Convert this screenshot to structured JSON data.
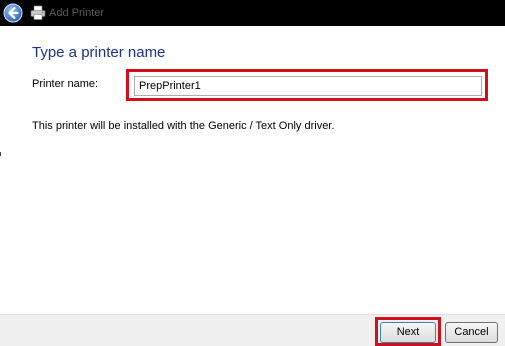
{
  "window": {
    "title": "Add Printer",
    "back_icon": "back-arrow-icon",
    "app_icon": "printer-icon"
  },
  "content": {
    "heading": "Type a printer name",
    "printer_name_label": "Printer name:",
    "printer_name_value": "PrepPrinter1",
    "driver_message": "This printer will be installed with the Generic / Text Only driver."
  },
  "footer": {
    "next_label": "Next",
    "cancel_label": "Cancel"
  },
  "colors": {
    "heading": "#1e3287",
    "highlight": "#d0101c",
    "titlebar": "#000000"
  }
}
